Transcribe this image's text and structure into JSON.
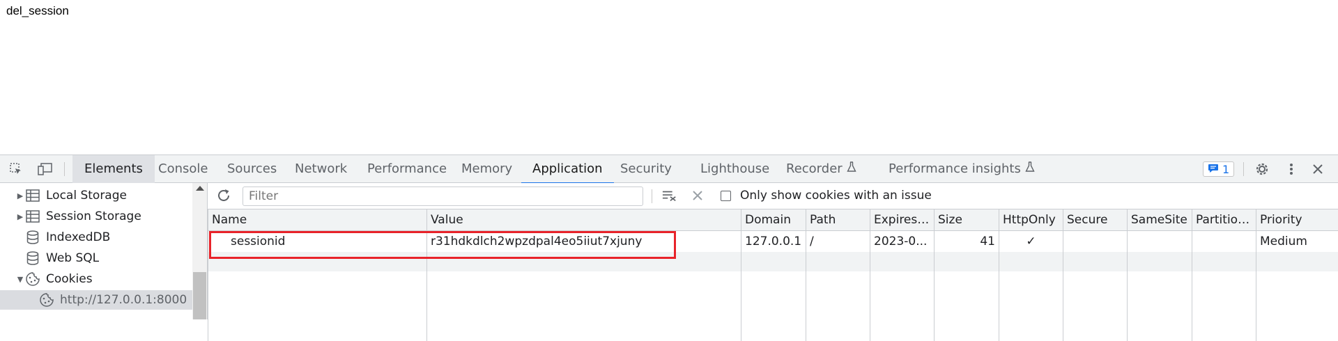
{
  "page": {
    "text": "del_session"
  },
  "devtools": {
    "tabs": [
      "Elements",
      "Console",
      "Sources",
      "Network",
      "Performance",
      "Memory",
      "Application",
      "Security",
      "Lighthouse",
      "Recorder",
      "Performance insights"
    ],
    "active_tab": "Application",
    "issues_count": "1"
  },
  "sidebar": {
    "items": [
      {
        "label": "Local Storage",
        "icon": "table-icon",
        "expanded": false
      },
      {
        "label": "Session Storage",
        "icon": "table-icon",
        "expanded": false
      },
      {
        "label": "IndexedDB",
        "icon": "database-icon"
      },
      {
        "label": "Web SQL",
        "icon": "database-icon"
      },
      {
        "label": "Cookies",
        "icon": "cookie-icon",
        "expanded": true
      },
      {
        "label": "http://127.0.0.1:8000",
        "icon": "cookie-icon",
        "selected": true
      }
    ]
  },
  "toolbar": {
    "filter_placeholder": "Filter",
    "only_issues_label": "Only show cookies with an issue",
    "only_issues_checked": false
  },
  "cookies": {
    "columns": [
      "Name",
      "Value",
      "Domain",
      "Path",
      "Expires ...",
      "Size",
      "HttpOnly",
      "Secure",
      "SameSite",
      "Partition...",
      "Priority"
    ],
    "rows": [
      {
        "name": "sessionid",
        "value": "r31hdkdlch2wpzdpal4eo5iiut7xjuny",
        "domain": "127.0.0.1",
        "path": "/",
        "expires": "2023-0...",
        "size": "41",
        "httponly": "✓",
        "secure": "",
        "samesite": "",
        "partition": "",
        "priority": "Medium"
      }
    ]
  },
  "colors": {
    "accent": "#1a73e8",
    "highlight": "#e8232a"
  }
}
